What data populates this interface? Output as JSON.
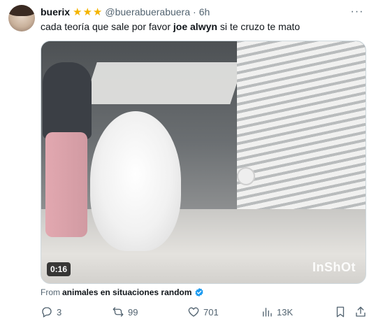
{
  "tweet": {
    "author_name": "buerix",
    "author_handle": "@buerabuerabuera",
    "separator": "·",
    "time": "6h",
    "more_label": "···",
    "text_before": "cada teoría que sale por favor ",
    "text_bold": "joe alwyn",
    "text_after": " si te cruzo te mato",
    "media": {
      "duration": "0:16",
      "watermark": "InShOt"
    },
    "from_label": "From",
    "from_source": "animales en situaciones random",
    "actions": {
      "replies": "3",
      "reposts": "99",
      "likes": "701",
      "views": "13K"
    }
  },
  "colors": {
    "star": "#f4b400",
    "verified": "#1d9bf0",
    "muted": "#536471"
  },
  "icons": [
    "star-icon",
    "more-icon",
    "verified-icon",
    "reply-icon",
    "repost-icon",
    "like-icon",
    "views-icon",
    "bookmark-icon",
    "share-icon"
  ]
}
